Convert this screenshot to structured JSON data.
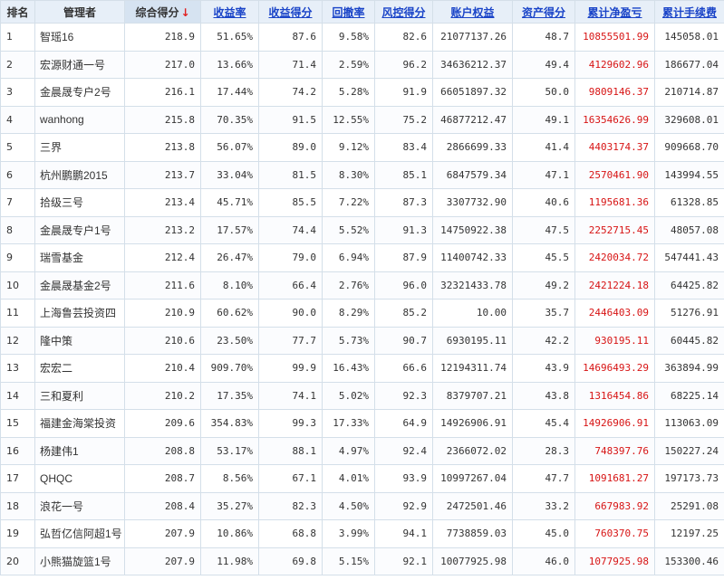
{
  "colors": {
    "header_bg": "#e7eff8",
    "link": "#1a44c8",
    "profit_red": "#d71414",
    "sort_arrow": "#e02020"
  },
  "headers": {
    "rank": "排名",
    "manager": "管理者",
    "composite": "综合得分",
    "return_rate": "收益率",
    "return_score": "收益得分",
    "drawdown": "回撤率",
    "risk_score": "风控得分",
    "equity": "账户权益",
    "asset_score": "资产得分",
    "net_profit": "累计净盈亏",
    "fees": "累计手续费"
  },
  "sort_icon": "arrow-down-icon",
  "rows": [
    {
      "rank": "1",
      "manager": "智瑶16",
      "composite": "218.9",
      "return_rate": "51.65%",
      "return_score": "87.6",
      "drawdown": "9.58%",
      "risk_score": "82.6",
      "equity": "21077137.26",
      "asset_score": "48.7",
      "net_profit": "10855501.99",
      "fees": "145058.01"
    },
    {
      "rank": "2",
      "manager": "宏源财通一号",
      "composite": "217.0",
      "return_rate": "13.66%",
      "return_score": "71.4",
      "drawdown": "2.59%",
      "risk_score": "96.2",
      "equity": "34636212.37",
      "asset_score": "49.4",
      "net_profit": "4129602.96",
      "fees": "186677.04"
    },
    {
      "rank": "3",
      "manager": "金晨晟专户2号",
      "composite": "216.1",
      "return_rate": "17.44%",
      "return_score": "74.2",
      "drawdown": "5.28%",
      "risk_score": "91.9",
      "equity": "66051897.32",
      "asset_score": "50.0",
      "net_profit": "9809146.37",
      "fees": "210714.87"
    },
    {
      "rank": "4",
      "manager": "wanhong",
      "composite": "215.8",
      "return_rate": "70.35%",
      "return_score": "91.5",
      "drawdown": "12.55%",
      "risk_score": "75.2",
      "equity": "46877212.47",
      "asset_score": "49.1",
      "net_profit": "16354626.99",
      "fees": "329608.01"
    },
    {
      "rank": "5",
      "manager": "三界",
      "composite": "213.8",
      "return_rate": "56.07%",
      "return_score": "89.0",
      "drawdown": "9.12%",
      "risk_score": "83.4",
      "equity": "2866699.33",
      "asset_score": "41.4",
      "net_profit": "4403174.37",
      "fees": "909668.70"
    },
    {
      "rank": "6",
      "manager": "杭州鹏鹏2015",
      "composite": "213.7",
      "return_rate": "33.04%",
      "return_score": "81.5",
      "drawdown": "8.30%",
      "risk_score": "85.1",
      "equity": "6847579.34",
      "asset_score": "47.1",
      "net_profit": "2570461.90",
      "fees": "143994.55"
    },
    {
      "rank": "7",
      "manager": "拾级三号",
      "composite": "213.4",
      "return_rate": "45.71%",
      "return_score": "85.5",
      "drawdown": "7.22%",
      "risk_score": "87.3",
      "equity": "3307732.90",
      "asset_score": "40.6",
      "net_profit": "1195681.36",
      "fees": "61328.85"
    },
    {
      "rank": "8",
      "manager": "金晨晟专户1号",
      "composite": "213.2",
      "return_rate": "17.57%",
      "return_score": "74.4",
      "drawdown": "5.52%",
      "risk_score": "91.3",
      "equity": "14750922.38",
      "asset_score": "47.5",
      "net_profit": "2252715.45",
      "fees": "48057.08"
    },
    {
      "rank": "9",
      "manager": "瑞雪基金",
      "composite": "212.4",
      "return_rate": "26.47%",
      "return_score": "79.0",
      "drawdown": "6.94%",
      "risk_score": "87.9",
      "equity": "11400742.33",
      "asset_score": "45.5",
      "net_profit": "2420034.72",
      "fees": "547441.43"
    },
    {
      "rank": "10",
      "manager": "金晨晟基金2号",
      "composite": "211.6",
      "return_rate": "8.10%",
      "return_score": "66.4",
      "drawdown": "2.76%",
      "risk_score": "96.0",
      "equity": "32321433.78",
      "asset_score": "49.2",
      "net_profit": "2421224.18",
      "fees": "64425.82"
    },
    {
      "rank": "11",
      "manager": "上海鲁芸投资四",
      "composite": "210.9",
      "return_rate": "60.62%",
      "return_score": "90.0",
      "drawdown": "8.29%",
      "risk_score": "85.2",
      "equity": "10.00",
      "asset_score": "35.7",
      "net_profit": "2446403.09",
      "fees": "51276.91"
    },
    {
      "rank": "12",
      "manager": "隆中策",
      "composite": "210.6",
      "return_rate": "23.50%",
      "return_score": "77.7",
      "drawdown": "5.73%",
      "risk_score": "90.7",
      "equity": "6930195.11",
      "asset_score": "42.2",
      "net_profit": "930195.11",
      "fees": "60445.82"
    },
    {
      "rank": "13",
      "manager": "宏宏二",
      "composite": "210.4",
      "return_rate": "909.70%",
      "return_score": "99.9",
      "drawdown": "16.43%",
      "risk_score": "66.6",
      "equity": "12194311.74",
      "asset_score": "43.9",
      "net_profit": "14696493.29",
      "fees": "363894.99"
    },
    {
      "rank": "14",
      "manager": "三和夏利",
      "composite": "210.2",
      "return_rate": "17.35%",
      "return_score": "74.1",
      "drawdown": "5.02%",
      "risk_score": "92.3",
      "equity": "8379707.21",
      "asset_score": "43.8",
      "net_profit": "1316454.86",
      "fees": "68225.14"
    },
    {
      "rank": "15",
      "manager": "福建金海棠投资",
      "composite": "209.6",
      "return_rate": "354.83%",
      "return_score": "99.3",
      "drawdown": "17.33%",
      "risk_score": "64.9",
      "equity": "14926906.91",
      "asset_score": "45.4",
      "net_profit": "14926906.91",
      "fees": "113063.09"
    },
    {
      "rank": "16",
      "manager": "杨建伟1",
      "composite": "208.8",
      "return_rate": "53.17%",
      "return_score": "88.1",
      "drawdown": "4.97%",
      "risk_score": "92.4",
      "equity": "2366072.02",
      "asset_score": "28.3",
      "net_profit": "748397.76",
      "fees": "150227.24"
    },
    {
      "rank": "17",
      "manager": "QHQC",
      "composite": "208.7",
      "return_rate": "8.56%",
      "return_score": "67.1",
      "drawdown": "4.01%",
      "risk_score": "93.9",
      "equity": "10997267.04",
      "asset_score": "47.7",
      "net_profit": "1091681.27",
      "fees": "197173.73"
    },
    {
      "rank": "18",
      "manager": "浪花一号",
      "composite": "208.4",
      "return_rate": "35.27%",
      "return_score": "82.3",
      "drawdown": "4.50%",
      "risk_score": "92.9",
      "equity": "2472501.46",
      "asset_score": "33.2",
      "net_profit": "667983.92",
      "fees": "25291.08"
    },
    {
      "rank": "19",
      "manager": "弘哲亿信阿超1号",
      "composite": "207.9",
      "return_rate": "10.86%",
      "return_score": "68.8",
      "drawdown": "3.99%",
      "risk_score": "94.1",
      "equity": "7738859.03",
      "asset_score": "45.0",
      "net_profit": "760370.75",
      "fees": "12197.25"
    },
    {
      "rank": "20",
      "manager": "小熊猫旋篮1号",
      "composite": "207.9",
      "return_rate": "11.98%",
      "return_score": "69.8",
      "drawdown": "5.15%",
      "risk_score": "92.1",
      "equity": "10077925.98",
      "asset_score": "46.0",
      "net_profit": "1077925.98",
      "fees": "153300.46"
    }
  ]
}
